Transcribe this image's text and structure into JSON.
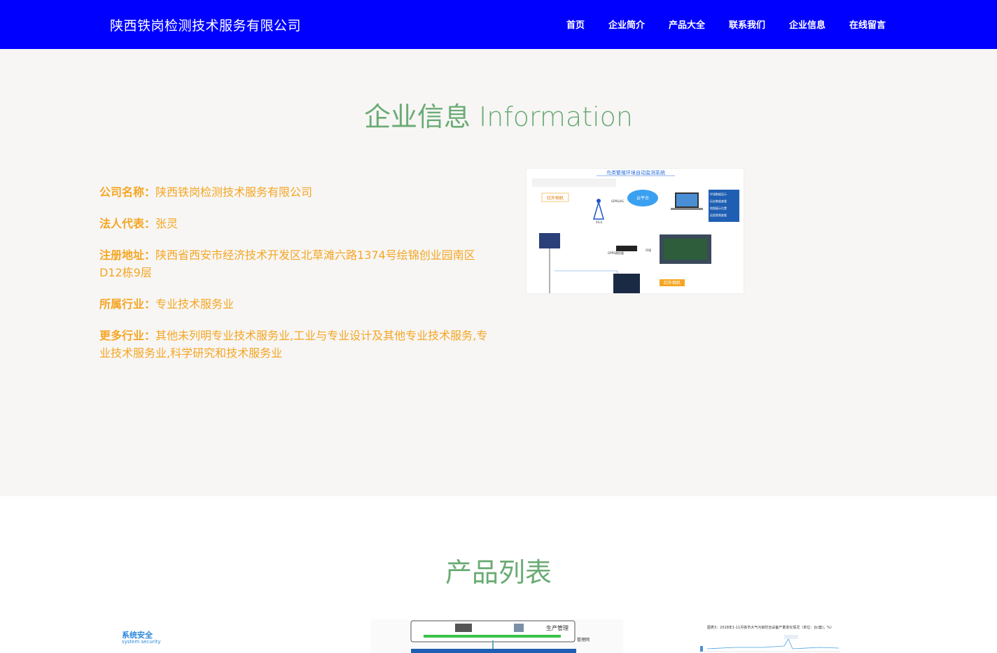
{
  "header": {
    "brand": "陕西铁岗检测技术服务有限公司",
    "nav": [
      "首页",
      "企业简介",
      "产品大全",
      "联系我们",
      "企业信息",
      "在线留言"
    ]
  },
  "info": {
    "title": "企业信息 Information",
    "rows": [
      {
        "label": "公司名称：",
        "value": "陕西铁岗检测技术服务有限公司"
      },
      {
        "label": "法人代表：",
        "value": "张灵"
      },
      {
        "label": "注册地址：",
        "value": "陕西省西安市经济技术开发区北草滩六路1374号绘锦创业园南区D12栋9层"
      },
      {
        "label": "所属行业：",
        "value": "专业技术服务业"
      },
      {
        "label": "更多行业：",
        "value": "其他未列明专业技术服务业,工业与专业设计及其他专业技术服务,专业技术服务业,科学研究和技术服务业"
      }
    ],
    "diagram": {
      "title": "鸟类繁殖环境自动监测系统",
      "labels": [
        "红外相机",
        "GPRS/4G",
        "云平台",
        "环境数据显示",
        "历史数据查看",
        "地图展示位置",
        "远程视频查看",
        "GPRS路由器",
        "环境",
        "红外相机",
        "4G卡"
      ]
    }
  },
  "products": {
    "title": "产品列表",
    "thumbs": [
      {
        "title": "系统安全",
        "subtitle": "system security"
      },
      {
        "label1": "生产管理",
        "label2": "管理网"
      },
      {
        "caption": "图表3：2018年1-11月各市大气污染防治设备产量变化情况（单位：台(套)，%）"
      }
    ]
  },
  "colors": {
    "header_bg": "#0000ff",
    "accent_green": "#6aab74",
    "info_text": "#f5a623",
    "section_bg": "#f7f6f5"
  }
}
